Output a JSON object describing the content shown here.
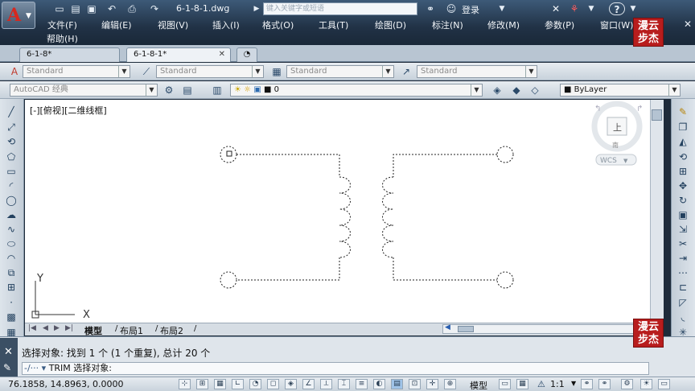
{
  "window": {
    "doc_title": "6-1-8-1.dwg",
    "search_placeholder": "键入关键字或短语",
    "login": "登录",
    "help_glyph": "?"
  },
  "menu": [
    "文件(F)",
    "编辑(E)",
    "视图(V)",
    "插入(I)",
    "格式(O)",
    "工具(T)",
    "绘图(D)",
    "标注(N)",
    "修改(M)",
    "参数(P)",
    "窗口(W)"
  ],
  "help_menu": "帮助(H)",
  "tabs": [
    {
      "label": "6-1-8*"
    },
    {
      "label": "6-1-8-1*",
      "active": true
    }
  ],
  "toolbar1": {
    "text_style": "Standard",
    "dim_style": "Standard",
    "table_style": "Standard",
    "multileader_style": "Standard"
  },
  "toolbar2": {
    "workspace": "AutoCAD 经典",
    "layer": "0",
    "color": "ByLayer"
  },
  "viewport": {
    "label": "[-][俯视][二维线框]",
    "viewcube_top": "上",
    "viewcube_south": "南",
    "wcs": "WCS",
    "ucs_x": "X",
    "ucs_y": "Y"
  },
  "layouts": [
    "模型",
    "布局1",
    "布局2"
  ],
  "command": {
    "history": "选择对象: 找到 1 个 (1 个重复), 总计 20 个",
    "prompt": "TRIM 选择对象:"
  },
  "status": {
    "coords": "76.1858, 14.8963, 0.0000",
    "model_label": "模型",
    "scale": "1:1"
  },
  "watermark": {
    "line1": "漫云",
    "line2": "步杰"
  },
  "colors": {
    "accent": "#d6281f",
    "drawing_line": "#222222",
    "watermark": "#b81d1d"
  }
}
